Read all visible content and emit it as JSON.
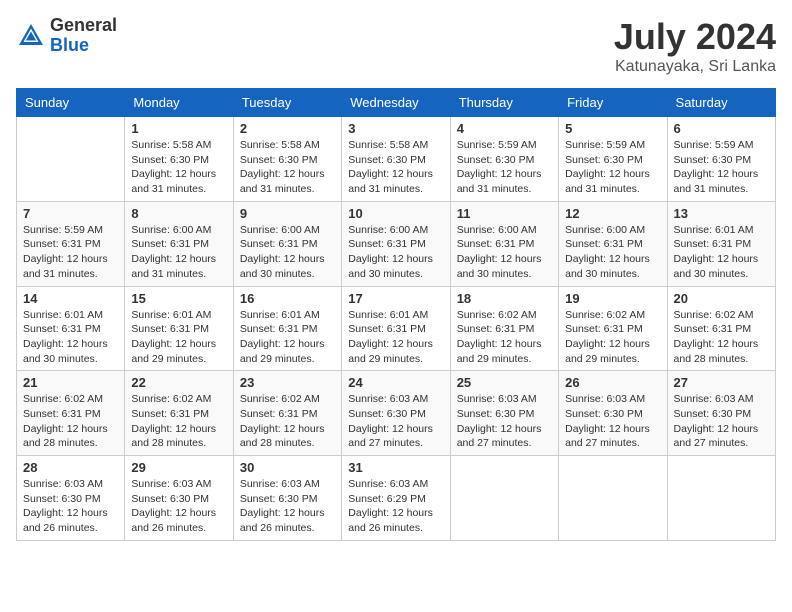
{
  "header": {
    "logo_general": "General",
    "logo_blue": "Blue",
    "month_year": "July 2024",
    "location": "Katunayaka, Sri Lanka"
  },
  "days_of_week": [
    "Sunday",
    "Monday",
    "Tuesday",
    "Wednesday",
    "Thursday",
    "Friday",
    "Saturday"
  ],
  "weeks": [
    [
      {
        "day": null,
        "info": null
      },
      {
        "day": "1",
        "sunrise": "5:58 AM",
        "sunset": "6:30 PM",
        "daylight": "12 hours and 31 minutes."
      },
      {
        "day": "2",
        "sunrise": "5:58 AM",
        "sunset": "6:30 PM",
        "daylight": "12 hours and 31 minutes."
      },
      {
        "day": "3",
        "sunrise": "5:58 AM",
        "sunset": "6:30 PM",
        "daylight": "12 hours and 31 minutes."
      },
      {
        "day": "4",
        "sunrise": "5:59 AM",
        "sunset": "6:30 PM",
        "daylight": "12 hours and 31 minutes."
      },
      {
        "day": "5",
        "sunrise": "5:59 AM",
        "sunset": "6:30 PM",
        "daylight": "12 hours and 31 minutes."
      },
      {
        "day": "6",
        "sunrise": "5:59 AM",
        "sunset": "6:30 PM",
        "daylight": "12 hours and 31 minutes."
      }
    ],
    [
      {
        "day": "7",
        "sunrise": "5:59 AM",
        "sunset": "6:31 PM",
        "daylight": "12 hours and 31 minutes."
      },
      {
        "day": "8",
        "sunrise": "6:00 AM",
        "sunset": "6:31 PM",
        "daylight": "12 hours and 31 minutes."
      },
      {
        "day": "9",
        "sunrise": "6:00 AM",
        "sunset": "6:31 PM",
        "daylight": "12 hours and 30 minutes."
      },
      {
        "day": "10",
        "sunrise": "6:00 AM",
        "sunset": "6:31 PM",
        "daylight": "12 hours and 30 minutes."
      },
      {
        "day": "11",
        "sunrise": "6:00 AM",
        "sunset": "6:31 PM",
        "daylight": "12 hours and 30 minutes."
      },
      {
        "day": "12",
        "sunrise": "6:00 AM",
        "sunset": "6:31 PM",
        "daylight": "12 hours and 30 minutes."
      },
      {
        "day": "13",
        "sunrise": "6:01 AM",
        "sunset": "6:31 PM",
        "daylight": "12 hours and 30 minutes."
      }
    ],
    [
      {
        "day": "14",
        "sunrise": "6:01 AM",
        "sunset": "6:31 PM",
        "daylight": "12 hours and 30 minutes."
      },
      {
        "day": "15",
        "sunrise": "6:01 AM",
        "sunset": "6:31 PM",
        "daylight": "12 hours and 29 minutes."
      },
      {
        "day": "16",
        "sunrise": "6:01 AM",
        "sunset": "6:31 PM",
        "daylight": "12 hours and 29 minutes."
      },
      {
        "day": "17",
        "sunrise": "6:01 AM",
        "sunset": "6:31 PM",
        "daylight": "12 hours and 29 minutes."
      },
      {
        "day": "18",
        "sunrise": "6:02 AM",
        "sunset": "6:31 PM",
        "daylight": "12 hours and 29 minutes."
      },
      {
        "day": "19",
        "sunrise": "6:02 AM",
        "sunset": "6:31 PM",
        "daylight": "12 hours and 29 minutes."
      },
      {
        "day": "20",
        "sunrise": "6:02 AM",
        "sunset": "6:31 PM",
        "daylight": "12 hours and 28 minutes."
      }
    ],
    [
      {
        "day": "21",
        "sunrise": "6:02 AM",
        "sunset": "6:31 PM",
        "daylight": "12 hours and 28 minutes."
      },
      {
        "day": "22",
        "sunrise": "6:02 AM",
        "sunset": "6:31 PM",
        "daylight": "12 hours and 28 minutes."
      },
      {
        "day": "23",
        "sunrise": "6:02 AM",
        "sunset": "6:31 PM",
        "daylight": "12 hours and 28 minutes."
      },
      {
        "day": "24",
        "sunrise": "6:03 AM",
        "sunset": "6:30 PM",
        "daylight": "12 hours and 27 minutes."
      },
      {
        "day": "25",
        "sunrise": "6:03 AM",
        "sunset": "6:30 PM",
        "daylight": "12 hours and 27 minutes."
      },
      {
        "day": "26",
        "sunrise": "6:03 AM",
        "sunset": "6:30 PM",
        "daylight": "12 hours and 27 minutes."
      },
      {
        "day": "27",
        "sunrise": "6:03 AM",
        "sunset": "6:30 PM",
        "daylight": "12 hours and 27 minutes."
      }
    ],
    [
      {
        "day": "28",
        "sunrise": "6:03 AM",
        "sunset": "6:30 PM",
        "daylight": "12 hours and 26 minutes."
      },
      {
        "day": "29",
        "sunrise": "6:03 AM",
        "sunset": "6:30 PM",
        "daylight": "12 hours and 26 minutes."
      },
      {
        "day": "30",
        "sunrise": "6:03 AM",
        "sunset": "6:30 PM",
        "daylight": "12 hours and 26 minutes."
      },
      {
        "day": "31",
        "sunrise": "6:03 AM",
        "sunset": "6:29 PM",
        "daylight": "12 hours and 26 minutes."
      },
      {
        "day": null,
        "info": null
      },
      {
        "day": null,
        "info": null
      },
      {
        "day": null,
        "info": null
      }
    ]
  ]
}
